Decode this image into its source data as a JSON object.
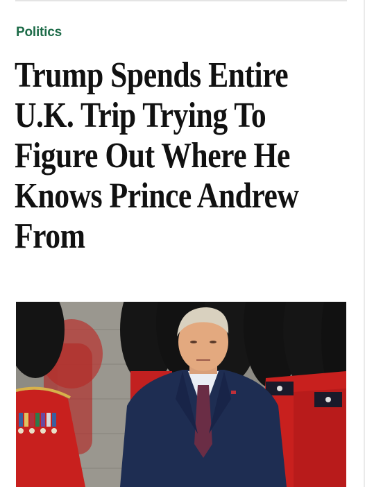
{
  "article": {
    "category": "Politics",
    "headline_lines": [
      "Trump Spends Entire",
      "U.K. Trip Trying To",
      "Figure Out Where He",
      "Knows Prince Andrew",
      "From"
    ]
  },
  "colors": {
    "category": "#1d6b48",
    "headline": "#111111",
    "guard_tunic": "#c8201e",
    "bearskin": "#141414",
    "suit": "#1e2d52",
    "tie": "#6a2d45"
  },
  "hero_image": {
    "icon": "news-photo"
  }
}
